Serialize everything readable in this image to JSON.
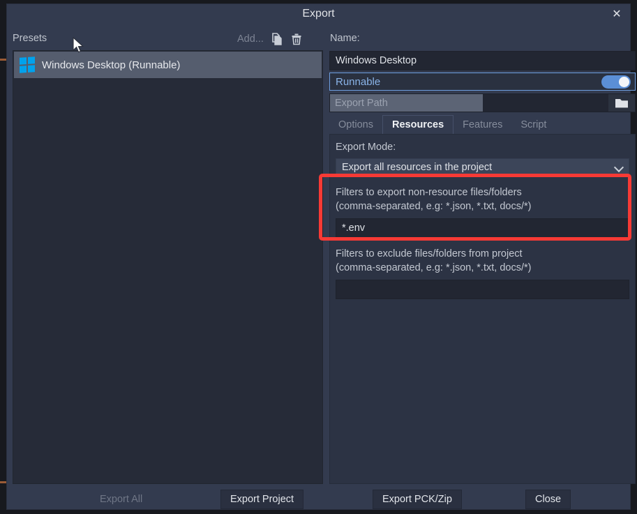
{
  "window": {
    "title": "Export",
    "close_icon": "close-icon"
  },
  "left_panel": {
    "presets_label": "Presets",
    "toolbar": {
      "add_label": "Add...",
      "duplicate_icon": "duplicate-icon",
      "delete_icon": "trash-icon"
    },
    "presets": [
      {
        "label": "Windows Desktop (Runnable)",
        "icon": "windows-logo-icon",
        "selected": true
      }
    ]
  },
  "right_panel": {
    "name_label": "Name:",
    "name_value": "Windows Desktop",
    "runnable": {
      "label": "Runnable",
      "enabled": true
    },
    "export_path": {
      "placeholder": "Export Path",
      "value": "",
      "browse_icon": "folder-icon"
    },
    "tabs": [
      {
        "label": "Options",
        "active": false
      },
      {
        "label": "Resources",
        "active": true
      },
      {
        "label": "Features",
        "active": false
      },
      {
        "label": "Script",
        "active": false
      }
    ],
    "resources_tab": {
      "export_mode_label": "Export Mode:",
      "export_mode_value": "Export all resources in the project",
      "include_filter": {
        "label_line1": "Filters to export non-resource files/folders",
        "label_line2": "(comma-separated, e.g: *.json, *.txt, docs/*)",
        "value": "*.env"
      },
      "exclude_filter": {
        "label_line1": "Filters to exclude files/folders from project",
        "label_line2": "(comma-separated, e.g: *.json, *.txt, docs/*)",
        "value": ""
      }
    }
  },
  "footer": {
    "export_all": "Export All",
    "export_project": "Export Project",
    "export_pck_zip": "Export PCK/Zip",
    "close": "Close"
  },
  "annotation": {
    "color": "#f73a35"
  }
}
